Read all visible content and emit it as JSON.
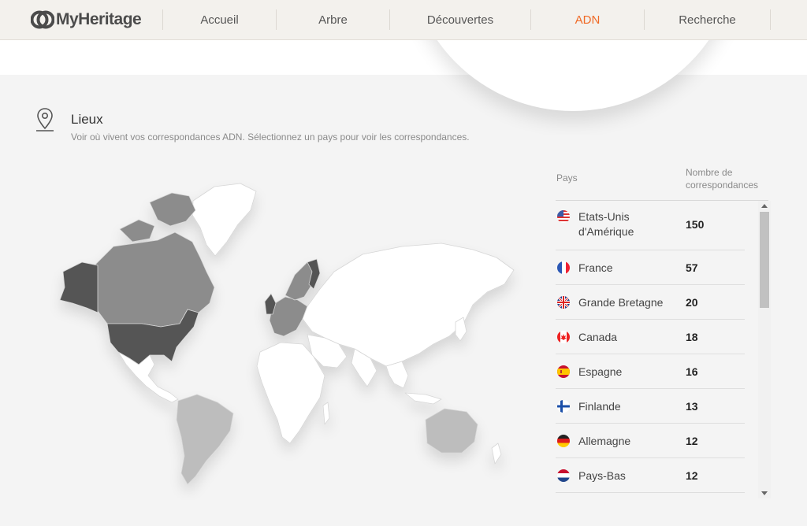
{
  "brand": {
    "name": "MyHeritage"
  },
  "nav": {
    "items": [
      {
        "label": "Accueil",
        "active": false
      },
      {
        "label": "Arbre",
        "active": false
      },
      {
        "label": "Découvertes",
        "active": false
      },
      {
        "label": "ADN",
        "active": true
      },
      {
        "label": "Recherche",
        "active": false
      }
    ]
  },
  "section": {
    "icon": "location-pin-icon",
    "title": "Lieux",
    "subtitle": "Voir où vivent vos correspondances ADN. Sélectionnez un pays pour voir les correspondances."
  },
  "table": {
    "col_country": "Pays",
    "col_count": "Nombre de correspondances",
    "rows": [
      {
        "country": "Etats-Unis d'Amérique",
        "count": "150",
        "flag": "us-flag-icon"
      },
      {
        "country": "France",
        "count": "57",
        "flag": "fr-flag-icon"
      },
      {
        "country": "Grande Bretagne",
        "count": "20",
        "flag": "gb-flag-icon"
      },
      {
        "country": "Canada",
        "count": "18",
        "flag": "ca-flag-icon"
      },
      {
        "country": "Espagne",
        "count": "16",
        "flag": "es-flag-icon"
      },
      {
        "country": "Finlande",
        "count": "13",
        "flag": "fi-flag-icon"
      },
      {
        "country": "Allemagne",
        "count": "12",
        "flag": "de-flag-icon"
      },
      {
        "country": "Pays-Bas",
        "count": "12",
        "flag": "nl-flag-icon"
      }
    ]
  },
  "colors": {
    "accent": "#f06a26",
    "map_high": "#555555",
    "map_mid": "#8c8c8c",
    "map_low": "#bdbdbd",
    "map_none": "#ffffff"
  }
}
